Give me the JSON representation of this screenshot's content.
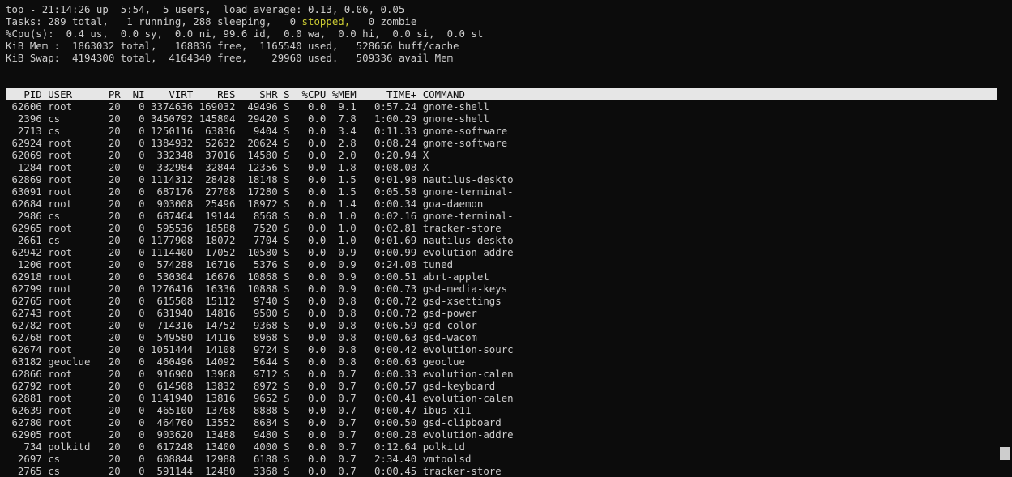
{
  "summary": {
    "line1": "top - 21:14:26 up  5:54,  5 users,  load average: 0.13, 0.06, 0.05",
    "line2_pre": "Tasks: 289 total,   1 running, 288 sleeping,   0 ",
    "line2_stopped": "stopped,",
    "line2_post": "   0 zombie",
    "line3": "%Cpu(s):  0.4 us,  0.0 sy,  0.0 ni, 99.6 id,  0.0 wa,  0.0 hi,  0.0 si,  0.0 st",
    "line4": "KiB Mem :  1863032 total,   168836 free,  1165540 used,   528656 buff/cache",
    "line5": "KiB Swap:  4194300 total,  4164340 free,    29960 used.   509336 avail Mem"
  },
  "table_header": "   PID USER      PR  NI    VIRT    RES    SHR S  %CPU %MEM     TIME+ COMMAND",
  "rows": [
    " 62606 root      20   0 3374636 169032  49496 S   0.0  9.1   0:57.24 gnome-shell",
    "  2396 cs        20   0 3450792 145804  29420 S   0.0  7.8   1:00.29 gnome-shell",
    "  2713 cs        20   0 1250116  63836   9404 S   0.0  3.4   0:11.33 gnome-software",
    " 62924 root      20   0 1384932  52632  20624 S   0.0  2.8   0:08.24 gnome-software",
    " 62069 root      20   0  332348  37016  14580 S   0.0  2.0   0:20.94 X",
    "  1284 root      20   0  332984  32844  12356 S   0.0  1.8   0:08.08 X",
    " 62869 root      20   0 1114312  28428  18148 S   0.0  1.5   0:01.98 nautilus-deskto",
    " 63091 root      20   0  687176  27708  17280 S   0.0  1.5   0:05.58 gnome-terminal-",
    " 62684 root      20   0  903008  25496  18972 S   0.0  1.4   0:00.34 goa-daemon",
    "  2986 cs        20   0  687464  19144   8568 S   0.0  1.0   0:02.16 gnome-terminal-",
    " 62965 root      20   0  595536  18588   7520 S   0.0  1.0   0:02.81 tracker-store",
    "  2661 cs        20   0 1177908  18072   7704 S   0.0  1.0   0:01.69 nautilus-deskto",
    " 62942 root      20   0 1114400  17052  10580 S   0.0  0.9   0:00.99 evolution-addre",
    "  1206 root      20   0  574288  16716   5376 S   0.0  0.9   0:24.08 tuned",
    " 62918 root      20   0  530304  16676  10868 S   0.0  0.9   0:00.51 abrt-applet",
    " 62799 root      20   0 1276416  16336  10888 S   0.0  0.9   0:00.73 gsd-media-keys",
    " 62765 root      20   0  615508  15112   9740 S   0.0  0.8   0:00.72 gsd-xsettings",
    " 62743 root      20   0  631940  14816   9500 S   0.0  0.8   0:00.72 gsd-power",
    " 62782 root      20   0  714316  14752   9368 S   0.0  0.8   0:06.59 gsd-color",
    " 62768 root      20   0  549580  14116   8968 S   0.0  0.8   0:00.63 gsd-wacom",
    " 62674 root      20   0 1051444  14108   9724 S   0.0  0.8   0:00.42 evolution-sourc",
    " 63182 geoclue   20   0  460496  14092   5644 S   0.0  0.8   0:00.63 geoclue",
    " 62866 root      20   0  916900  13968   9712 S   0.0  0.7   0:00.33 evolution-calen",
    " 62792 root      20   0  614508  13832   8972 S   0.0  0.7   0:00.57 gsd-keyboard",
    " 62881 root      20   0 1141940  13816   9652 S   0.0  0.7   0:00.41 evolution-calen",
    " 62639 root      20   0  465100  13768   8888 S   0.0  0.7   0:00.47 ibus-x11",
    " 62780 root      20   0  464760  13552   8684 S   0.0  0.7   0:00.50 gsd-clipboard",
    " 62905 root      20   0  903620  13488   9480 S   0.0  0.7   0:00.28 evolution-addre",
    "   734 polkitd   20   0  617248  13400   4000 S   0.0  0.7   0:12.64 polkitd",
    "  2697 cs        20   0  608844  12988   6188 S   0.0  0.7   2:34.40 vmtoolsd",
    "  2765 cs        20   0  591144  12480   3368 S   0.0  0.7   0:00.45 tracker-store"
  ],
  "colors": {
    "background": "#0c0c0c",
    "text": "#cccccc",
    "highlight": "#cccc33",
    "header_bg": "#e6e6e6"
  }
}
